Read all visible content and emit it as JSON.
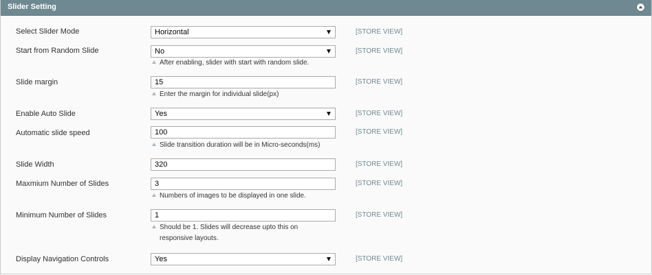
{
  "panel": {
    "title": "Slider Setting",
    "collapse_icon": "chevron-up-icon"
  },
  "scope_label": "[STORE VIEW]",
  "rows": [
    {
      "label": "Select Slider Mode",
      "type": "select",
      "value": "Horizontal",
      "note": ""
    },
    {
      "label": "Start from Random Slide",
      "type": "select",
      "value": "No",
      "note": "After enabling, slider with start with random slide."
    },
    {
      "label": "Slide margin",
      "type": "input",
      "value": "15",
      "note": "Enter the margin for individual slide(px)"
    },
    {
      "label": "Enable Auto Slide",
      "type": "select",
      "value": "Yes",
      "note": ""
    },
    {
      "label": "Automatic slide speed",
      "type": "input",
      "value": "100",
      "note": "Slide transition duration will be in Micro-seconds(ms)"
    },
    {
      "label": "Slide Width",
      "type": "input",
      "value": "320",
      "note": ""
    },
    {
      "label": "Maxmium Number of Slides",
      "type": "input",
      "value": "3",
      "note": "Numbers of images to be displayed in one slide."
    },
    {
      "label": "Minimum Number of Slides",
      "type": "input",
      "value": "1",
      "note_line1": "Should be 1. Slides will decrease upto this on",
      "note_line2": "responsive layouts."
    },
    {
      "label": "Display Navigation Controls",
      "type": "select",
      "value": "Yes",
      "note": ""
    }
  ],
  "colors": {
    "header_bg": "#6f8992",
    "scope_text": "#6f8992",
    "panel_bg": "#fafafa"
  }
}
